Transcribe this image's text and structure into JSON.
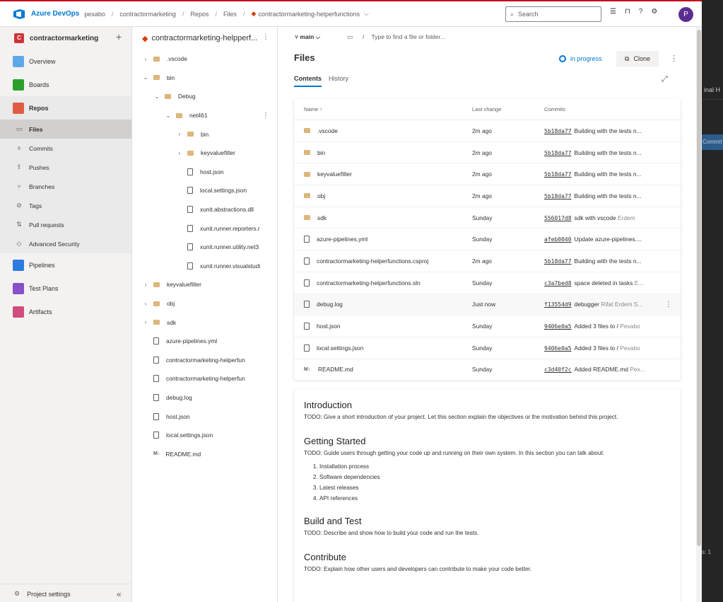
{
  "topbar": {
    "brand": "Azure DevOps",
    "breadcrumbs": [
      "pexabo",
      "contractormarketing",
      "Repos",
      "Files",
      "contractormarketing-helperfunctions"
    ],
    "search_placeholder": "Search",
    "avatar_initial": "P"
  },
  "project": {
    "badge": "C",
    "name": "contractormarketing"
  },
  "nav": {
    "items": [
      {
        "label": "Overview",
        "color": "#5ea8e8"
      },
      {
        "label": "Boards",
        "color": "#2ca02c"
      },
      {
        "label": "Repos",
        "color": "#e05d44"
      }
    ],
    "repos_sub": [
      {
        "label": "Files",
        "icon": "▭"
      },
      {
        "label": "Commits",
        "icon": "⌽"
      },
      {
        "label": "Pushes",
        "icon": "⇪"
      },
      {
        "label": "Branches",
        "icon": "⑂"
      },
      {
        "label": "Tags",
        "icon": "⊘"
      },
      {
        "label": "Pull requests",
        "icon": "⇅"
      },
      {
        "label": "Advanced Security",
        "icon": "◇"
      }
    ],
    "items2": [
      {
        "label": "Pipelines",
        "color": "#2e7be0"
      },
      {
        "label": "Test Plans",
        "color": "#8a4fc9"
      },
      {
        "label": "Artifacts",
        "color": "#d14b7d"
      }
    ],
    "settings": "Project settings"
  },
  "tree": {
    "repo": "contractormarketing-helpperf...",
    "rows": [
      {
        "label": ".vscode",
        "depth": 0,
        "type": "folder",
        "chev": "›"
      },
      {
        "label": "bin",
        "depth": 0,
        "type": "folder",
        "chev": "⌄"
      },
      {
        "label": "Debug",
        "depth": 1,
        "type": "folder",
        "chev": "⌄"
      },
      {
        "label": "net461",
        "depth": 2,
        "type": "folder",
        "chev": "⌄"
      },
      {
        "label": "bin",
        "depth": 3,
        "type": "folder",
        "chev": "›"
      },
      {
        "label": "keyvaluefilter",
        "depth": 3,
        "type": "folder",
        "chev": "›"
      },
      {
        "label": "host.json",
        "depth": 3,
        "type": "file",
        "chev": ""
      },
      {
        "label": "local.settings.json",
        "depth": 3,
        "type": "file",
        "chev": ""
      },
      {
        "label": "xunit.abstractions.dll",
        "depth": 3,
        "type": "file",
        "chev": ""
      },
      {
        "label": "xunit.runner.reporters.r",
        "depth": 3,
        "type": "file",
        "chev": ""
      },
      {
        "label": "xunit.runner.utility.net3",
        "depth": 3,
        "type": "file",
        "chev": ""
      },
      {
        "label": "xunit.runner.visualstudi",
        "depth": 3,
        "type": "file",
        "chev": ""
      },
      {
        "label": "keyvaluefilter",
        "depth": 0,
        "type": "folder",
        "chev": "›"
      },
      {
        "label": "obj",
        "depth": 0,
        "type": "folder",
        "chev": "›"
      },
      {
        "label": "sdk",
        "depth": 0,
        "type": "folder",
        "chev": "›"
      },
      {
        "label": "azure-pipelines.yml",
        "depth": 0,
        "type": "file",
        "chev": ""
      },
      {
        "label": "contractormarketing-helperfun",
        "depth": 0,
        "type": "file",
        "chev": ""
      },
      {
        "label": "contractormarketing-helperfun",
        "depth": 0,
        "type": "file",
        "chev": ""
      },
      {
        "label": "debug.log",
        "depth": 0,
        "type": "file",
        "chev": ""
      },
      {
        "label": "host.json",
        "depth": 0,
        "type": "file",
        "chev": ""
      },
      {
        "label": "local.settings.json",
        "depth": 0,
        "type": "file",
        "chev": ""
      },
      {
        "label": "README.md",
        "depth": 0,
        "type": "md",
        "chev": ""
      }
    ]
  },
  "main": {
    "branch": "main",
    "path_placeholder": "Type to find a file or folder...",
    "title": "Files",
    "status": "in progress",
    "clone": "Clone",
    "tabs": [
      "Contents",
      "History"
    ],
    "columns": [
      "Name ↑",
      "Last change",
      "Commits"
    ],
    "files": [
      {
        "name": ".vscode",
        "type": "folder",
        "change": "2m ago",
        "hash": "5b18da77",
        "msg": "Building with the tests n...",
        "author": ""
      },
      {
        "name": "bin",
        "type": "folder",
        "change": "2m ago",
        "hash": "5b18da77",
        "msg": "Building with the tests n...",
        "author": ""
      },
      {
        "name": "keyvaluefilter",
        "type": "folder",
        "change": "2m ago",
        "hash": "5b18da77",
        "msg": "Building with the tests n...",
        "author": ""
      },
      {
        "name": "obj",
        "type": "folder",
        "change": "2m ago",
        "hash": "5b18da77",
        "msg": "Building with the tests n...",
        "author": ""
      },
      {
        "name": "sdk",
        "type": "folder",
        "change": "Sunday",
        "hash": "556017d8",
        "msg": "sdk with vscode",
        "author": "Erdem"
      },
      {
        "name": "azure-pipelines.yml",
        "type": "doc",
        "change": "Sunday",
        "hash": "afeb0040",
        "msg": "Update azure-pipelines....",
        "author": ""
      },
      {
        "name": "contractormarketing-helperfunctions.csproj",
        "type": "doc",
        "change": "2m ago",
        "hash": "5b18da77",
        "msg": "Building with the tests n...",
        "author": ""
      },
      {
        "name": "contractormarketing-helperfunctions.sln",
        "type": "doc",
        "change": "Sunday",
        "hash": "c3a7bed8",
        "msg": "space deleted in tasks",
        "author": "E..."
      },
      {
        "name": "debug.log",
        "type": "doc",
        "change": "Just now",
        "hash": "f13554d9",
        "msg": "debugger",
        "author": "Rifat Erdem S..."
      },
      {
        "name": "host.json",
        "type": "doc",
        "change": "Sunday",
        "hash": "9406e0a5",
        "msg": "Added 3 files to /",
        "author": "Pexabo"
      },
      {
        "name": "local.settings.json",
        "type": "doc",
        "change": "Sunday",
        "hash": "9406e0a5",
        "msg": "Added 3 files to /",
        "author": "Pexabo"
      },
      {
        "name": "README.md",
        "type": "md",
        "change": "Sunday",
        "hash": "c3d40f2c",
        "msg": "Added README.md",
        "author": "Pex..."
      }
    ]
  },
  "readme": {
    "intro_h": "Introduction",
    "intro_p": "TODO: Give a short introduction of your project. Let this section explain the objectives or the motivation behind this project.",
    "gs_h": "Getting Started",
    "gs_p": "TODO: Guide users through getting your code up and running on their own system. In this section you can talk about:",
    "gs_list": [
      "Installation process",
      "Software dependencies",
      "Latest releases",
      "API references"
    ],
    "bt_h": "Build and Test",
    "bt_p": "TODO: Describe and show how to build your code and run the tests.",
    "co_h": "Contribute",
    "co_p": "TODO: Explain how other users and developers can contribute to make your code better."
  },
  "background": {
    "t1": "inal  H",
    "t2": "Commit",
    "t3": "s: 1"
  }
}
